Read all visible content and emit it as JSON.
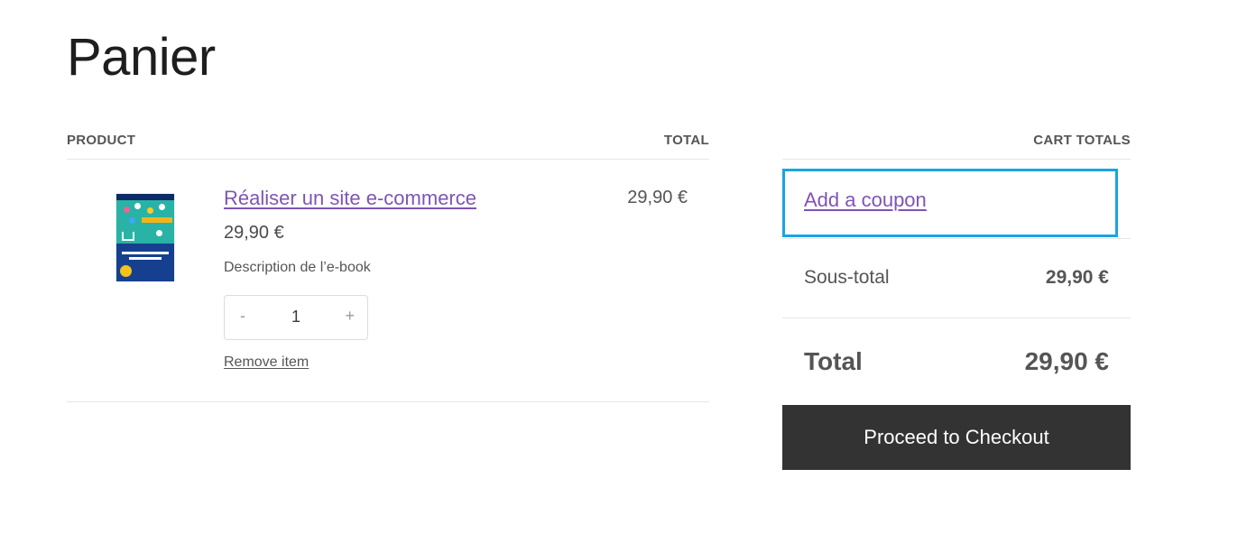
{
  "page": {
    "title": "Panier"
  },
  "cart": {
    "headers": {
      "product": "PRODUCT",
      "total": "TOTAL"
    },
    "items": [
      {
        "name": "Réaliser un site e-commerce",
        "price": "29,90 €",
        "description": "Description de l’e-book",
        "quantity": "1",
        "quantity_minus": "-",
        "quantity_plus": "+",
        "remove_label": "Remove item",
        "line_total": "29,90 €"
      }
    ]
  },
  "totals": {
    "heading": "CART TOTALS",
    "coupon_label": "Add a coupon",
    "subtotal_label": "Sous-total",
    "subtotal_value": "29,90 €",
    "total_label": "Total",
    "total_value": "29,90 €",
    "checkout_label": "Proceed to Checkout"
  },
  "colors": {
    "link": "#7f54b3",
    "highlight_border": "#1aa5e0",
    "button_bg": "#333333",
    "text": "#555555"
  }
}
